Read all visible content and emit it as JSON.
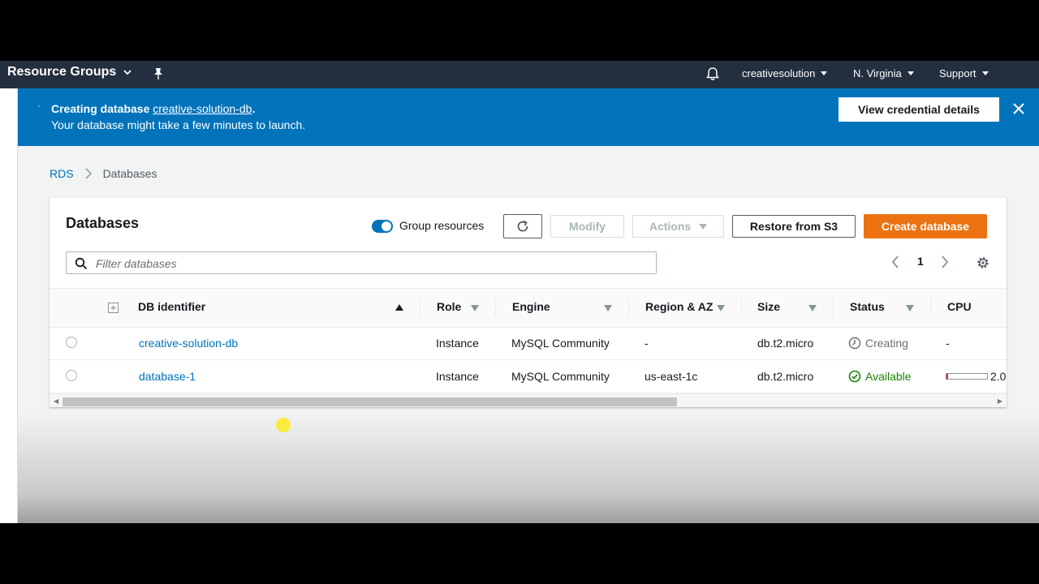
{
  "topnav": {
    "resource_groups": "Resource Groups",
    "account": "creativesolution",
    "region": "N. Virginia",
    "support": "Support"
  },
  "flash": {
    "prefix": "Creating database ",
    "db_link": "creative-solution-db",
    "suffix": ".",
    "message": "Your database might take a few minutes to launch.",
    "view_credentials": "View credential details"
  },
  "breadcrumb": {
    "root": "RDS",
    "current": "Databases"
  },
  "panel": {
    "title": "Databases",
    "group_resources": "Group resources",
    "modify": "Modify",
    "actions": "Actions",
    "restore": "Restore from S3",
    "create": "Create database",
    "filter_placeholder": "Filter databases",
    "page": "1"
  },
  "columns": [
    "DB identifier",
    "Role",
    "Engine",
    "Region & AZ",
    "Size",
    "Status",
    "CPU"
  ],
  "rows": [
    {
      "identifier": "creative-solution-db",
      "role": "Instance",
      "engine": "MySQL Community",
      "region": "-",
      "size": "db.t2.micro",
      "status": "Creating",
      "cpu": "-"
    },
    {
      "identifier": "database-1",
      "role": "Instance",
      "engine": "MySQL Community",
      "region": "us-east-1c",
      "size": "db.t2.micro",
      "status": "Available",
      "cpu": "2.0",
      "cpu_fraction": 0.02
    }
  ],
  "colors": {
    "nav": "#232f3e",
    "flash": "#0073bb",
    "primary": "#ec7211",
    "link": "#0073bb",
    "success": "#1d8102",
    "muted": "#687078"
  },
  "icons": [
    "chevron-down-icon",
    "pin-icon",
    "bell-icon",
    "spinner-icon",
    "close-icon",
    "chevron-right-icon",
    "refresh-icon",
    "search-icon",
    "chevron-left-icon",
    "settings-icon",
    "expand-icon",
    "clock-icon",
    "check-circle-icon"
  ]
}
